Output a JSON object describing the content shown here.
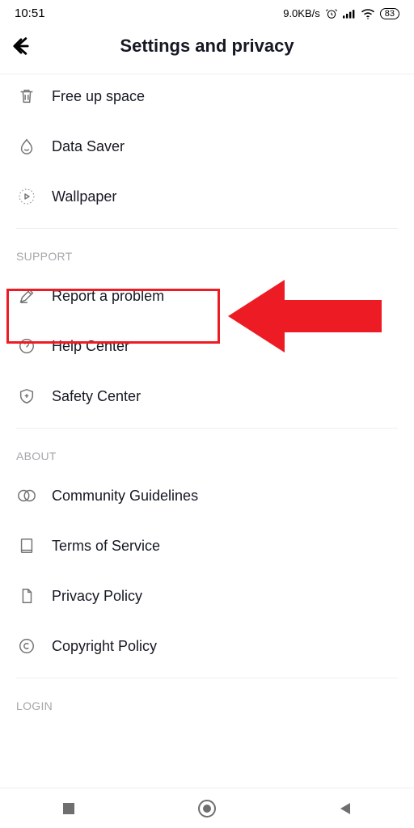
{
  "status": {
    "time": "10:51",
    "speed": "9.0KB/s",
    "battery": "83"
  },
  "header": {
    "title": "Settings and privacy"
  },
  "sections": {
    "cache_items": {
      "i0": "Free up space",
      "i1": "Data Saver",
      "i2": "Wallpaper"
    },
    "support": {
      "label": "SUPPORT",
      "i0": "Report a problem",
      "i1": "Help Center",
      "i2": "Safety Center"
    },
    "about": {
      "label": "ABOUT",
      "i0": "Community Guidelines",
      "i1": "Terms of Service",
      "i2": "Privacy Policy",
      "i3": "Copyright Policy"
    },
    "login": {
      "label": "LOGIN"
    }
  },
  "annotation": {
    "highlight_color": "#ed1c24"
  }
}
